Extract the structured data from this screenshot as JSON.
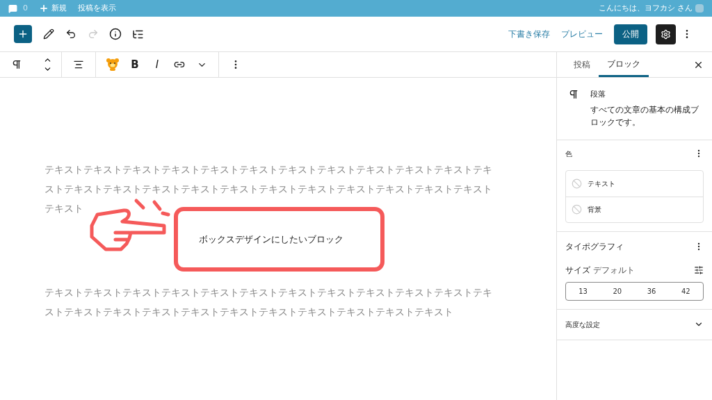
{
  "admin_bar": {
    "comments": "0",
    "new": "新規",
    "view_post": "投稿を表示",
    "greeting": "こんにちは、ヨフカシ さん"
  },
  "format_toolbar": {
    "bold": "B",
    "italic": "I"
  },
  "header": {
    "undo_disabled": false,
    "redo_disabled": true,
    "save_draft": "下書き保存",
    "preview": "プレビュー",
    "publish": "公開",
    "settings_selected": true
  },
  "content": {
    "paragraphs": [
      "テキストテキストテキストテキストテキストテキストテキストテキストテキストテキストテキストテキストテキストテキストテキストテキストテキストテキストテキストテキストテキストテキストテキストテキスト",
      "テキストテキストテキストテキストテキストテキストテキストテキストテキストテキストテキストテキストテキストテキストテキストテキストテキストテキストテキストテキストテキストテキスト"
    ],
    "callout": "ボックスデザインにしたいブロック"
  },
  "sidebar": {
    "tabs": [
      {
        "label": "投稿",
        "selected": false
      },
      {
        "label": "ブロック",
        "selected": true
      }
    ],
    "block": {
      "name": "段落",
      "description": "すべての文章の基本の構成ブロックです。"
    },
    "color": {
      "title": "色",
      "items": [
        "テキスト",
        "背景"
      ]
    },
    "typography": {
      "title": "タイポグラフィ",
      "size_label": "サイズ",
      "size_value": "デフォルト",
      "sizes": [
        {
          "label": "13",
          "selected": false
        },
        {
          "label": "20",
          "selected": false
        },
        {
          "label": "36",
          "selected": false
        },
        {
          "label": "42",
          "selected": false
        }
      ]
    },
    "advanced": {
      "title": "高度な設定",
      "expanded": false
    }
  }
}
